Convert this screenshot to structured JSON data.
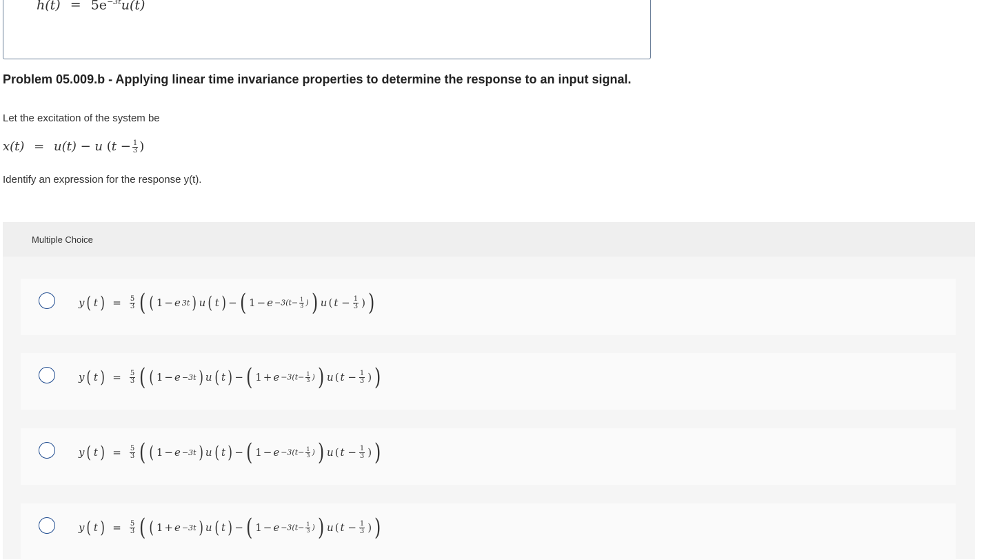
{
  "previous_box": {
    "h_expression": {
      "lhs": "h(t)",
      "eq": "=",
      "coef": "5e",
      "exp": "−3t",
      "tail": "u(t)"
    }
  },
  "problem": {
    "title": "Problem 05.009.b - Applying linear time invariance properties to determine the response to an input signal.",
    "intro": "Let the excitation of the system be",
    "x_expression": {
      "lhs": "x(t)",
      "eq": "=",
      "rhs_a": "u(t) − u",
      "frac_num": "1",
      "frac_den": "3"
    },
    "identify": "Identify an expression for the response y(t)."
  },
  "multiple_choice": {
    "header": "Multiple Choice",
    "options": [
      {
        "sign_inner": "−",
        "exp_inner": "3t",
        "sign_outer": "−",
        "exp_outer": "−3"
      },
      {
        "sign_inner": "−",
        "exp_inner": "−3t",
        "sign_outer": "+",
        "exp_outer": "−3"
      },
      {
        "sign_inner": "−",
        "exp_inner": "−3t",
        "sign_outer": "−",
        "exp_outer": "−3"
      },
      {
        "sign_inner": "+",
        "exp_inner": "−3t",
        "sign_outer": "−",
        "exp_outer": "−3"
      }
    ],
    "common": {
      "y": "y",
      "t": "t",
      "eq": "=",
      "coef_num": "5",
      "coef_den": "3",
      "one": "1",
      "e": "e",
      "u": "u",
      "third_num": "1",
      "third_den": "3"
    }
  }
}
